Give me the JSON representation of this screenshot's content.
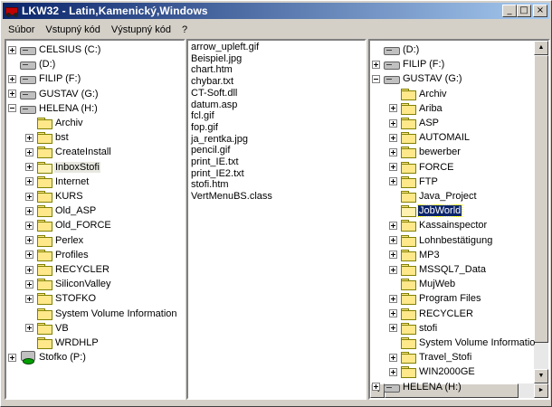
{
  "window": {
    "title": "LKW32 - Latin,Kamenický,Windows",
    "minimize": "_",
    "maximize": "□",
    "close": "×"
  },
  "menu": [
    "Súbor",
    "Vstupný kód",
    "Výstupný kód",
    "?"
  ],
  "left_tree": [
    {
      "label": "CELSIUS (C:)",
      "type": "drive",
      "exp": "plus",
      "level": 0
    },
    {
      "label": "(D:)",
      "type": "drive",
      "exp": "none",
      "level": 0
    },
    {
      "label": "FILIP (F:)",
      "type": "drive",
      "exp": "plus",
      "level": 0
    },
    {
      "label": "GUSTAV (G:)",
      "type": "drive",
      "exp": "plus",
      "level": 0
    },
    {
      "label": "HELENA (H:)",
      "type": "drive",
      "exp": "minus",
      "level": 0
    },
    {
      "label": "Archiv",
      "type": "folder",
      "exp": "none",
      "level": 1
    },
    {
      "label": "bst",
      "type": "folder",
      "exp": "plus",
      "level": 1
    },
    {
      "label": "CreateInstall",
      "type": "folder",
      "exp": "plus",
      "level": 1
    },
    {
      "label": "InboxStofi",
      "type": "folder-open",
      "exp": "plus",
      "level": 1,
      "state": "highlighted"
    },
    {
      "label": "Internet",
      "type": "folder",
      "exp": "plus",
      "level": 1
    },
    {
      "label": "KURS",
      "type": "folder",
      "exp": "plus",
      "level": 1
    },
    {
      "label": "Old_ASP",
      "type": "folder",
      "exp": "plus",
      "level": 1
    },
    {
      "label": "Old_FORCE",
      "type": "folder",
      "exp": "plus",
      "level": 1
    },
    {
      "label": "Perlex",
      "type": "folder",
      "exp": "plus",
      "level": 1
    },
    {
      "label": "Profiles",
      "type": "folder",
      "exp": "plus",
      "level": 1
    },
    {
      "label": "RECYCLER",
      "type": "folder",
      "exp": "plus",
      "level": 1
    },
    {
      "label": "SiliconValley",
      "type": "folder",
      "exp": "plus",
      "level": 1
    },
    {
      "label": "STOFKO",
      "type": "folder",
      "exp": "plus",
      "level": 1
    },
    {
      "label": "System Volume Information",
      "type": "folder",
      "exp": "none",
      "level": 1
    },
    {
      "label": "VB",
      "type": "folder",
      "exp": "plus",
      "level": 1
    },
    {
      "label": "WRDHLP",
      "type": "folder",
      "exp": "none",
      "level": 1
    },
    {
      "label": "Stofko (P:)",
      "type": "net",
      "exp": "plus",
      "level": 0
    }
  ],
  "files": [
    "arrow_upleft.gif",
    "Beispiel.jpg",
    "chart.htm",
    "chybar.txt",
    "CT-Soft.dll",
    "datum.asp",
    "fcl.gif",
    "fop.gif",
    "ja_rentka.jpg",
    "pencil.gif",
    "print_IE.txt",
    "print_IE2.txt",
    "stofi.htm",
    "VertMenuBS.class"
  ],
  "right_tree": [
    {
      "label": "(D:)",
      "type": "drive",
      "exp": "none",
      "level": 0
    },
    {
      "label": "FILIP (F:)",
      "type": "drive",
      "exp": "plus",
      "level": 0
    },
    {
      "label": "GUSTAV (G:)",
      "type": "drive",
      "exp": "minus",
      "level": 0
    },
    {
      "label": "Archiv",
      "type": "folder",
      "exp": "none",
      "level": 1
    },
    {
      "label": "Ariba",
      "type": "folder",
      "exp": "plus",
      "level": 1
    },
    {
      "label": "ASP",
      "type": "folder",
      "exp": "plus",
      "level": 1
    },
    {
      "label": "AUTOMAIL",
      "type": "folder",
      "exp": "plus",
      "level": 1
    },
    {
      "label": "bewerber",
      "type": "folder",
      "exp": "plus",
      "level": 1
    },
    {
      "label": "FORCE",
      "type": "folder",
      "exp": "plus",
      "level": 1
    },
    {
      "label": "FTP",
      "type": "folder",
      "exp": "plus",
      "level": 1
    },
    {
      "label": "Java_Project",
      "type": "folder",
      "exp": "none",
      "level": 1
    },
    {
      "label": "JobWorld",
      "type": "folder-open",
      "exp": "none",
      "level": 1,
      "state": "selected"
    },
    {
      "label": "Kassainspector",
      "type": "folder",
      "exp": "plus",
      "level": 1
    },
    {
      "label": "Lohnbestätigung",
      "type": "folder",
      "exp": "plus",
      "level": 1
    },
    {
      "label": "MP3",
      "type": "folder",
      "exp": "plus",
      "level": 1
    },
    {
      "label": "MSSQL7_Data",
      "type": "folder",
      "exp": "plus",
      "level": 1
    },
    {
      "label": "MujWeb",
      "type": "folder",
      "exp": "none",
      "level": 1
    },
    {
      "label": "Program Files",
      "type": "folder",
      "exp": "plus",
      "level": 1
    },
    {
      "label": "RECYCLER",
      "type": "folder",
      "exp": "plus",
      "level": 1
    },
    {
      "label": "stofi",
      "type": "folder",
      "exp": "plus",
      "level": 1
    },
    {
      "label": "System Volume Informatio",
      "type": "folder",
      "exp": "none",
      "level": 1
    },
    {
      "label": "Travel_Stofi",
      "type": "folder",
      "exp": "plus",
      "level": 1
    },
    {
      "label": "WIN2000GE",
      "type": "folder",
      "exp": "plus",
      "level": 1
    },
    {
      "label": "HELENA (H:)",
      "type": "drive",
      "exp": "plus",
      "level": 0
    }
  ],
  "scroll": {
    "up": "▲",
    "down": "▼",
    "left": "◄",
    "right": "►"
  }
}
